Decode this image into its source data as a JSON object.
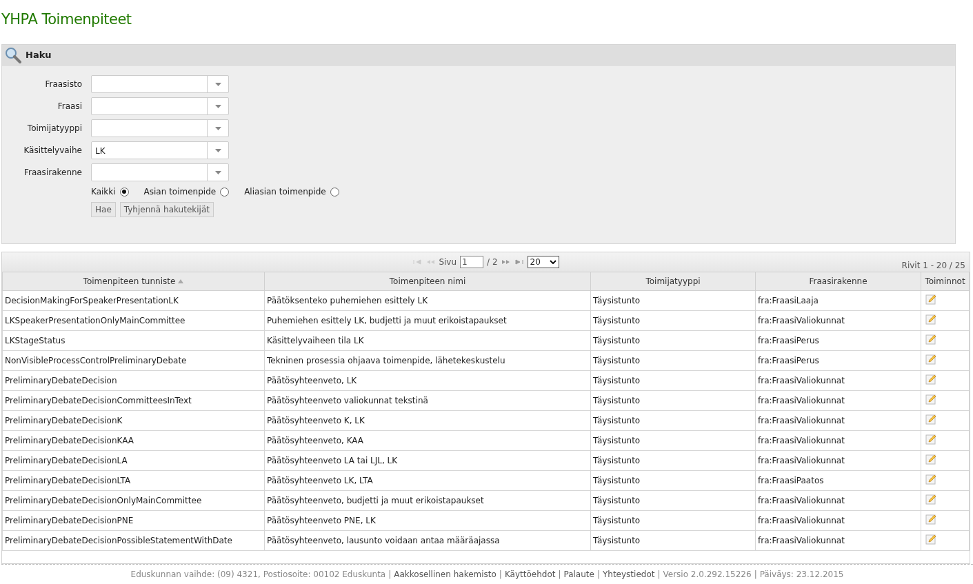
{
  "title": "YHPA Toimenpiteet",
  "search": {
    "title": "Haku",
    "fields": [
      {
        "label": "Fraasisto"
      },
      {
        "label": "Fraasi"
      },
      {
        "label": "Toimijatyyppi"
      },
      {
        "label": "Käsittelyvaihe",
        "value": "LK"
      },
      {
        "label": "Fraasirakenne"
      }
    ],
    "radios": [
      {
        "label": "Kaikki",
        "selected": true
      },
      {
        "label": "Asian toimenpide",
        "selected": false
      },
      {
        "label": "Aliasian toimenpide",
        "selected": false
      }
    ],
    "buttons": [
      "Hae",
      "Tyhjennä hakutekijät"
    ]
  },
  "pager": {
    "page_label": "Sivu",
    "page": "1",
    "total": "/ 2",
    "page_size": "20",
    "rows_info": "Rivit 1 - 20 / 25"
  },
  "table": {
    "columns": [
      {
        "label": "Toimenpiteen tunniste",
        "sorted": true
      },
      {
        "label": "Toimenpiteen nimi",
        "sorted": false
      },
      {
        "label": "Toimijatyyppi",
        "sorted": false
      },
      {
        "label": "Fraasirakenne",
        "sorted": false
      },
      {
        "label": "Toiminnot",
        "sorted": false
      }
    ],
    "rows": [
      [
        "DecisionMakingForSpeakerPresentationLK",
        "Päätöksenteko puhemiehen esittely LK",
        "Täysistunto",
        "fra:FraasiLaaja"
      ],
      [
        "LKSpeakerPresentationOnlyMainCommittee",
        "Puhemiehen esittely LK, budjetti ja muut erikoistapaukset",
        "Täysistunto",
        "fra:FraasiValiokunnat"
      ],
      [
        "LKStageStatus",
        "Käsittelyvaiheen tila LK",
        "Täysistunto",
        "fra:FraasiPerus"
      ],
      [
        "NonVisibleProcessControlPreliminaryDebate",
        "Tekninen prosessia ohjaava toimenpide, lähetekeskustelu",
        "Täysistunto",
        "fra:FraasiPerus"
      ],
      [
        "PreliminaryDebateDecision",
        "Päätösyhteenveto, LK",
        "Täysistunto",
        "fra:FraasiValiokunnat"
      ],
      [
        "PreliminaryDebateDecisionCommitteesInText",
        "Päätösyhteenveto valiokunnat tekstinä",
        "Täysistunto",
        "fra:FraasiValiokunnat"
      ],
      [
        "PreliminaryDebateDecisionK",
        "Päätösyhteenveto K, LK",
        "Täysistunto",
        "fra:FraasiValiokunnat"
      ],
      [
        "PreliminaryDebateDecisionKAA",
        "Päätösyhteenveto, KAA",
        "Täysistunto",
        "fra:FraasiValiokunnat"
      ],
      [
        "PreliminaryDebateDecisionLA",
        "Päätösyhteenveto LA tai LJL,  LK",
        "Täysistunto",
        "fra:FraasiValiokunnat"
      ],
      [
        "PreliminaryDebateDecisionLTA",
        "Päätösyhteenveto LK, LTA",
        "Täysistunto",
        "fra:FraasiPaatos"
      ],
      [
        "PreliminaryDebateDecisionOnlyMainCommittee",
        "Päätösyhteenveto, budjetti ja muut erikoistapaukset",
        "Täysistunto",
        "fra:FraasiValiokunnat"
      ],
      [
        "PreliminaryDebateDecisionPNE",
        "Päätösyhteenveto PNE, LK",
        "Täysistunto",
        "fra:FraasiValiokunnat"
      ],
      [
        "PreliminaryDebateDecisionPossibleStatementWithDate",
        "Päätösyhteenveto, lausunto voidaan antaa määräajassa",
        "Täysistunto",
        "fra:FraasiValiokunnat"
      ]
    ]
  },
  "footer": [
    {
      "kind": "text",
      "text": "Eduskunnan vaihde: (09) 4321, Postiosoite: 00102 Eduskunta"
    },
    {
      "kind": "separator",
      "text": "|"
    },
    {
      "kind": "link",
      "text": "Aakkosellinen hakemisto"
    },
    {
      "kind": "separator",
      "text": "|"
    },
    {
      "kind": "link",
      "text": "Käyttöehdot"
    },
    {
      "kind": "separator",
      "text": "|"
    },
    {
      "kind": "link",
      "text": "Palaute"
    },
    {
      "kind": "separator",
      "text": "|"
    },
    {
      "kind": "link",
      "text": "Yhteystiedot"
    },
    {
      "kind": "separator",
      "text": "|"
    },
    {
      "kind": "text",
      "text": "Versio 2.0.292.15226"
    },
    {
      "kind": "separator",
      "text": "|"
    },
    {
      "kind": "text",
      "text": "Päiväys: 23.12.2015"
    }
  ]
}
